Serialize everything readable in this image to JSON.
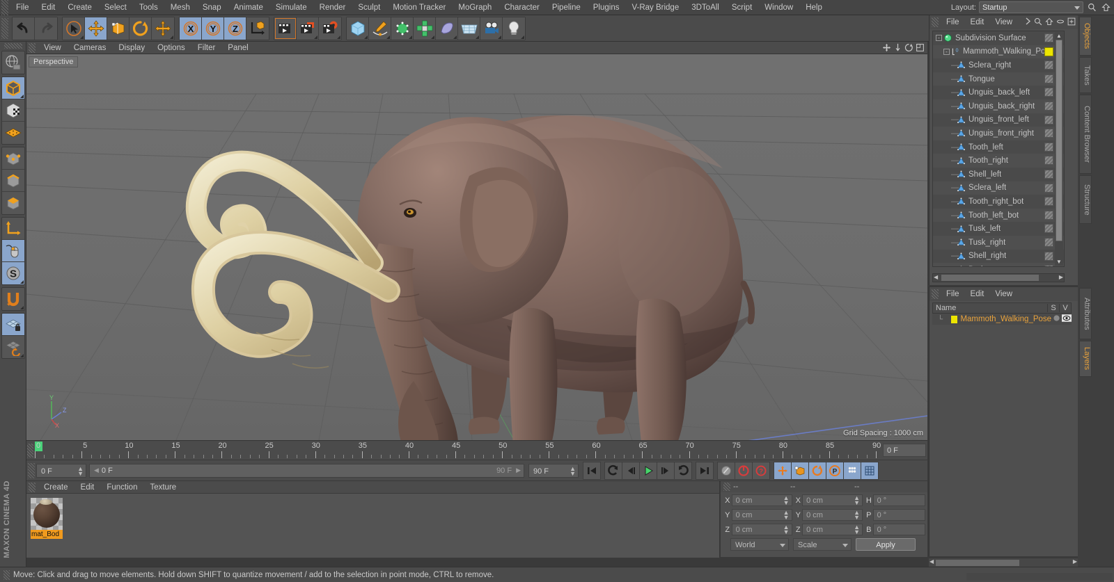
{
  "menubar": {
    "items": [
      "File",
      "Edit",
      "Create",
      "Select",
      "Tools",
      "Mesh",
      "Snap",
      "Animate",
      "Simulate",
      "Render",
      "Sculpt",
      "Motion Tracker",
      "MoGraph",
      "Character",
      "Pipeline",
      "Plugins",
      "V-Ray Bridge",
      "3DToAll",
      "Script",
      "Window",
      "Help"
    ],
    "layout_label": "Layout:",
    "layout_value": "Startup"
  },
  "toolbar": {
    "groups": [
      {
        "name": "history",
        "buttons": [
          {
            "icon": "undo-icon",
            "label": "Undo",
            "active": false
          },
          {
            "icon": "redo-icon",
            "label": "Redo",
            "active": false
          }
        ]
      },
      {
        "name": "tools",
        "buttons": [
          {
            "icon": "live-selection-icon",
            "label": "Live Selection",
            "active": false
          },
          {
            "icon": "move-icon",
            "label": "Move",
            "active": true
          },
          {
            "icon": "scale-icon",
            "label": "Scale",
            "active": false
          },
          {
            "icon": "rotate-icon",
            "label": "Rotate",
            "active": false
          },
          {
            "icon": "move-alt-icon",
            "label": "Move Tool",
            "active": false
          }
        ]
      },
      {
        "name": "axis-locks",
        "buttons": [
          {
            "icon": "axis-x-icon",
            "label": "X",
            "active": true
          },
          {
            "icon": "axis-y-icon",
            "label": "Y",
            "active": true
          },
          {
            "icon": "axis-z-icon",
            "label": "Z",
            "active": true
          },
          {
            "icon": "world-coordinates-icon",
            "label": "World/Object",
            "active": false
          }
        ]
      },
      {
        "name": "render",
        "buttons": [
          {
            "icon": "render-view-icon",
            "label": "Render View",
            "active": false
          },
          {
            "icon": "render-picture-viewer-icon",
            "label": "Render to Picture Viewer",
            "active": false
          },
          {
            "icon": "render-settings-icon",
            "label": "Edit Render Settings",
            "active": false
          }
        ]
      },
      {
        "name": "objects",
        "buttons": [
          {
            "icon": "cube-primitive-icon",
            "label": "Add Cube Object",
            "active": false
          },
          {
            "icon": "spline-pen-icon",
            "label": "Add Spline",
            "active": false
          },
          {
            "icon": "generator-icon",
            "label": "Add Generator",
            "active": false
          },
          {
            "icon": "deformer-icon",
            "label": "Add Deformer",
            "active": false
          },
          {
            "icon": "scene-object-icon",
            "label": "Add Scene Object",
            "active": false
          },
          {
            "icon": "environment-icon",
            "label": "Add Environment",
            "active": false
          },
          {
            "icon": "camera-icon",
            "label": "Add Camera",
            "active": false
          },
          {
            "icon": "light-icon",
            "label": "Add Light",
            "active": false
          }
        ]
      }
    ]
  },
  "left_palette": {
    "groups": [
      {
        "buttons": [
          {
            "icon": "make-editable-icon",
            "label": "Make Editable",
            "active": false
          }
        ]
      },
      {
        "buttons": [
          {
            "icon": "model-mode-icon",
            "label": "Model Mode",
            "active": true
          },
          {
            "icon": "texture-mode-icon",
            "label": "Texture Mode",
            "active": false
          },
          {
            "icon": "workplane-mode-icon",
            "label": "Workplane Mode",
            "active": false
          }
        ]
      },
      {
        "buttons": [
          {
            "icon": "points-mode-icon",
            "label": "Points Mode",
            "active": false
          },
          {
            "icon": "edges-mode-icon",
            "label": "Edges Mode",
            "active": false
          },
          {
            "icon": "polygons-mode-icon",
            "label": "Polygons Mode",
            "active": false
          }
        ]
      },
      {
        "buttons": [
          {
            "icon": "object-axis-icon",
            "label": "Enable Axis Modification",
            "active": false
          },
          {
            "icon": "viewport-solo-icon",
            "label": "Viewport Solo Mode",
            "active": true
          },
          {
            "icon": "soft-selection-icon",
            "label": "Soft Selection",
            "active": true
          }
        ]
      },
      {
        "buttons": [
          {
            "icon": "magnet-icon",
            "label": "Magnet Tool",
            "active": false
          }
        ]
      },
      {
        "buttons": [
          {
            "icon": "lock-workplane-icon",
            "label": "Lock Workplane",
            "active": true
          },
          {
            "icon": "planar-workplane-icon",
            "label": "Planar Workplane Mode",
            "active": false
          }
        ]
      }
    ],
    "brand": "MAXON CINEMA 4D"
  },
  "viewport": {
    "menu": [
      "View",
      "Cameras",
      "Display",
      "Options",
      "Filter",
      "Panel"
    ],
    "camera_label": "Perspective",
    "grid_spacing": "Grid Spacing : 1000 cm",
    "axis": {
      "x": "X",
      "y": "Y",
      "z": "Z"
    },
    "scene_subject": "Mammoth walking pose 3D model"
  },
  "timeline": {
    "start_frame": "0 F",
    "end_frame": "90 F",
    "current_frame": "0 F",
    "preview_end": "90 F",
    "field_right": "0 F",
    "major_ticks": [
      0,
      5,
      10,
      15,
      20,
      25,
      30,
      35,
      40,
      45,
      50,
      55,
      60,
      65,
      70,
      75,
      80,
      85,
      90
    ],
    "playhead_frame": 0
  },
  "transport": {
    "buttons": [
      {
        "icon": "go-to-start-icon",
        "label": "Go to Start"
      },
      {
        "icon": "play-backwards-loop-icon",
        "label": "Play Backwards"
      },
      {
        "icon": "step-back-icon",
        "label": "Go to Previous Frame"
      },
      {
        "icon": "play-forward-icon",
        "label": "Play Forward"
      },
      {
        "icon": "step-forward-icon",
        "label": "Go to Next Frame"
      },
      {
        "icon": "loop-icon",
        "label": "Play Forward Loop"
      },
      {
        "icon": "go-to-end-icon",
        "label": "Go to End"
      }
    ],
    "record_group": [
      {
        "icon": "autokey-icon",
        "label": "Autokeying",
        "active": false
      },
      {
        "icon": "record-icon",
        "label": "Record Active Objects",
        "active": false
      },
      {
        "icon": "keyframe-selection-icon",
        "label": "Keyframe Selection",
        "active": false
      }
    ],
    "key_group": [
      {
        "icon": "position-key-icon",
        "label": "Position",
        "active": true
      },
      {
        "icon": "scale-key-icon",
        "label": "Scale",
        "active": true
      },
      {
        "icon": "rotation-key-icon",
        "label": "Rotation",
        "active": true
      },
      {
        "icon": "parameter-key-icon",
        "label": "Parameter (P)",
        "active": true
      },
      {
        "icon": "pla-key-icon",
        "label": "Point Level Animation",
        "active": true
      },
      {
        "icon": "timeline-icon",
        "label": "Timeline",
        "active": true
      }
    ]
  },
  "material_manager": {
    "menu": [
      "Create",
      "Edit",
      "Function",
      "Texture"
    ],
    "materials": [
      {
        "name": "mat_Bod",
        "full_name": "mat_Body",
        "selected": true
      }
    ]
  },
  "coordinates": {
    "headers": [
      "--",
      "--",
      "--"
    ],
    "rows": [
      {
        "label1": "X",
        "value1": "0 cm",
        "label2": "X",
        "value2": "0 cm",
        "label3": "H",
        "value3": "0 °"
      },
      {
        "label1": "Y",
        "value1": "0 cm",
        "label2": "Y",
        "value2": "0 cm",
        "label3": "P",
        "value3": "0 °"
      },
      {
        "label1": "Z",
        "value1": "0 cm",
        "label2": "Z",
        "value2": "0 cm",
        "label3": "B",
        "value3": "0 °"
      }
    ],
    "system": "World",
    "mode": "Scale",
    "apply_label": "Apply"
  },
  "object_manager": {
    "menu": [
      "File",
      "Edit",
      "View"
    ],
    "items": [
      {
        "name": "Subdivision Surface",
        "icon": "subdivision-surface-icon",
        "depth": 0,
        "expander": "-",
        "tag": "texture"
      },
      {
        "name": "Mammoth_Walking_Pose",
        "icon": "null-object-icon",
        "depth": 1,
        "expander": "-",
        "tag": "yellow"
      },
      {
        "name": "Sclera_right",
        "icon": "polygon-object-icon",
        "depth": 2,
        "expander": "",
        "tag": "texture"
      },
      {
        "name": "Tongue",
        "icon": "polygon-object-icon",
        "depth": 2,
        "expander": "",
        "tag": "texture"
      },
      {
        "name": "Unguis_back_left",
        "icon": "polygon-object-icon",
        "depth": 2,
        "expander": "",
        "tag": "texture"
      },
      {
        "name": "Unguis_back_right",
        "icon": "polygon-object-icon",
        "depth": 2,
        "expander": "",
        "tag": "texture"
      },
      {
        "name": "Unguis_front_left",
        "icon": "polygon-object-icon",
        "depth": 2,
        "expander": "",
        "tag": "texture"
      },
      {
        "name": "Unguis_front_right",
        "icon": "polygon-object-icon",
        "depth": 2,
        "expander": "",
        "tag": "texture"
      },
      {
        "name": "Tooth_left",
        "icon": "polygon-object-icon",
        "depth": 2,
        "expander": "",
        "tag": "texture"
      },
      {
        "name": "Tooth_right",
        "icon": "polygon-object-icon",
        "depth": 2,
        "expander": "",
        "tag": "texture"
      },
      {
        "name": "Shell_left",
        "icon": "polygon-object-icon",
        "depth": 2,
        "expander": "",
        "tag": "texture"
      },
      {
        "name": "Sclera_left",
        "icon": "polygon-object-icon",
        "depth": 2,
        "expander": "",
        "tag": "texture"
      },
      {
        "name": "Tooth_right_bot",
        "icon": "polygon-object-icon",
        "depth": 2,
        "expander": "",
        "tag": "texture"
      },
      {
        "name": "Tooth_left_bot",
        "icon": "polygon-object-icon",
        "depth": 2,
        "expander": "",
        "tag": "texture"
      },
      {
        "name": "Tusk_left",
        "icon": "polygon-object-icon",
        "depth": 2,
        "expander": "",
        "tag": "texture"
      },
      {
        "name": "Tusk_right",
        "icon": "polygon-object-icon",
        "depth": 2,
        "expander": "",
        "tag": "texture"
      },
      {
        "name": "Shell_right",
        "icon": "polygon-object-icon",
        "depth": 2,
        "expander": "",
        "tag": "texture"
      },
      {
        "name": "Body",
        "icon": "polygon-object-icon",
        "depth": 2,
        "expander": "",
        "tag": "texture"
      }
    ]
  },
  "layer_manager": {
    "menu": [
      "File",
      "Edit",
      "View"
    ],
    "columns": {
      "name": "Name",
      "s": "S",
      "v": "V"
    },
    "rows": [
      {
        "name": "Mammoth_Walking_Pose",
        "color": "#ece500"
      }
    ]
  },
  "right_tabs": [
    {
      "label": "Objects",
      "active": true
    },
    {
      "label": "Takes",
      "active": false
    },
    {
      "label": "Content Browser",
      "active": false
    },
    {
      "label": "Structure",
      "active": false
    },
    {
      "label": "Attributes",
      "active": false
    },
    {
      "label": "Layers",
      "active": true
    }
  ],
  "statusbar": {
    "text": "Move: Click and drag to move elements. Hold down SHIFT to quantize movement / add to the selection in point mode, CTRL to remove."
  },
  "colors": {
    "accent_orange": "#e8a23c",
    "highlight_blue": "#8aa6cc",
    "panel_bg": "#4b4b4b",
    "viewport_bg": "#6e6e6e",
    "yellow_tag": "#ece500"
  }
}
